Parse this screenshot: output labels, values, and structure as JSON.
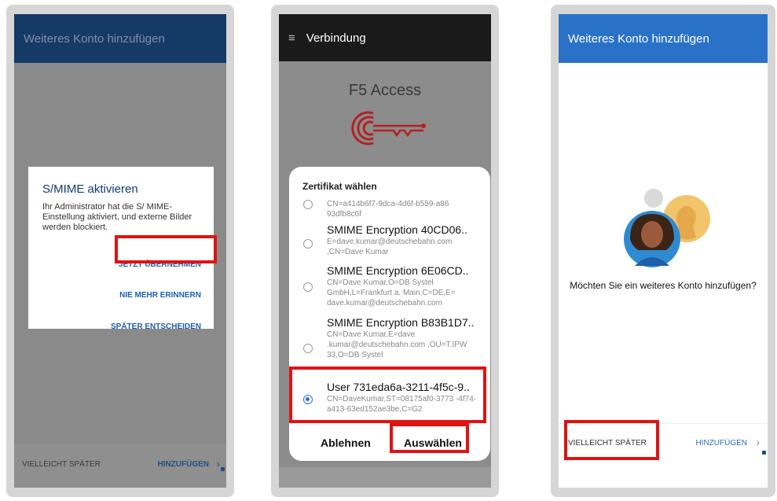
{
  "screen1": {
    "appbar_title": "Weiteres Konto hinzufügen",
    "dialog": {
      "title": "S/MIME aktivieren",
      "body": "Ihr Administrator hat die S/ MIME-Einstellung aktiviert, und externe Bilder werden blockiert.",
      "actions": [
        "JETZT ÜBERNEHMEN",
        "NIE MEHR ERINNERN",
        "SPÄTER ENTSCHEIDEN"
      ]
    },
    "footer": {
      "left": "VIELLEICHT SPÄTER",
      "right": "HINZUFÜGEN"
    }
  },
  "screen2": {
    "appbar_title": "Verbindung",
    "app_name": "F5 Access",
    "sheet": {
      "title": "Zertifikat wählen",
      "certs": [
        {
          "name": "",
          "detail": "CN=a414b6f7-9dca-4d6f-b559-a86 93dfb8c6f",
          "selected": false
        },
        {
          "name": "SMIME Encryption 40CD06..",
          "detail": "E=dave.kumar@deutschebahn.com ,CN=Dave Kumar",
          "selected": false
        },
        {
          "name": "SMIME Encryption 6E06CD..",
          "detail": "CN=Dave Kumar,O=DB Systel GmbH,L=Frankfurt a. Main,C=DE,E= dave.kumar@deutschebahn.com",
          "selected": false
        },
        {
          "name": "SMIME Encryption B83B1D7..",
          "detail": "CN=Dave Kumar,E=dave .kumar@deutschebahn.com ,OU=T.IPW 33,O=DB Systel",
          "selected": false
        },
        {
          "name": "User 731eda6a-3211-4f5c-9..",
          "detail": "CN=DaveKumar,ST=08175af0-3773 -4f74-a413-63ed152ae3be,C=G2",
          "selected": true
        }
      ],
      "cancel": "Ablehnen",
      "confirm": "Auswählen"
    }
  },
  "screen3": {
    "appbar_title": "Weiteres Konto hinzufügen",
    "question": "Möchten Sie ein weiteres Konto hinzufügen?",
    "footer": {
      "left": "VIELLEICHT SPÄTER",
      "right": "HINZUFÜGEN"
    }
  },
  "colors": {
    "highlight": "#e01313",
    "outlook_blue": "#2a72c8",
    "radio_blue": "#2f6fd1"
  }
}
